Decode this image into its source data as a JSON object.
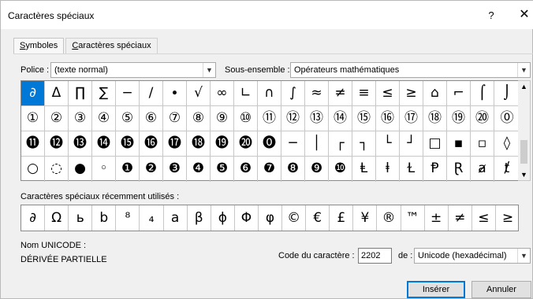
{
  "window": {
    "title": "Caractères spéciaux",
    "help": "?",
    "close": "✕"
  },
  "tabs": [
    {
      "label": "Symboles",
      "mnemonic": "S",
      "rest": "ymboles",
      "active": true
    },
    {
      "label": "Caractères spéciaux",
      "mnemonic": "C",
      "rest": "aractères spéciaux",
      "active": false
    }
  ],
  "police": {
    "label": "Police :",
    "value": "(texte normal)"
  },
  "subset": {
    "label": "Sous-ensemble :",
    "value": "Opérateurs mathématiques"
  },
  "symbol_grid": {
    "selected_index": 0,
    "rows": [
      [
        "∂",
        "Δ",
        "∏",
        "∑",
        "−",
        "∕",
        "∙",
        "√",
        "∞",
        "∟",
        "∩",
        "∫",
        "≈",
        "≠",
        "≡",
        "≤",
        "≥",
        "⌂",
        "⌐",
        "⌠",
        "⌡"
      ],
      [
        "①",
        "②",
        "③",
        "④",
        "⑤",
        "⑥",
        "⑦",
        "⑧",
        "⑨",
        "⑩",
        "⑪",
        "⑫",
        "⑬",
        "⑭",
        "⑮",
        "⑯",
        "⑰",
        "⑱",
        "⑲",
        "⑳",
        "⓪"
      ],
      [
        "⓫",
        "⓬",
        "⓭",
        "⓮",
        "⓯",
        "⓰",
        "⓱",
        "⓲",
        "⓳",
        "⓴",
        "⓿",
        "─",
        "│",
        "┌",
        "┐",
        "└",
        "┘",
        "□",
        "▪",
        "▫",
        "◊"
      ],
      [
        "○",
        "◌",
        "●",
        "◦",
        "❶",
        "❷",
        "❸",
        "❹",
        "❺",
        "❻",
        "❼",
        "❽",
        "❾",
        "❿",
        "Ⱡ",
        "ⱡ",
        "Ɫ",
        "Ᵽ",
        "Ɽ",
        "ⱥ",
        "ⱦ"
      ]
    ]
  },
  "recent": {
    "label": "Caractères spéciaux récemment utilisés :",
    "items": [
      "∂",
      "Ω",
      "ь",
      "b",
      "⁸",
      "₄",
      "a",
      "β",
      "ϕ",
      "Φ",
      "φ",
      "©",
      "€",
      "£",
      "¥",
      "®",
      "™",
      "±",
      "≠",
      "≤",
      "≥"
    ]
  },
  "unicode": {
    "label": "Nom UNICODE :",
    "name": "DÉRIVÉE PARTIELLE"
  },
  "char_code": {
    "label": "Code du caractère :",
    "value": "2202"
  },
  "from": {
    "label": "de :",
    "value": "Unicode (hexadécimal)"
  },
  "buttons": {
    "insert": "Insérer",
    "cancel": "Annuler"
  }
}
